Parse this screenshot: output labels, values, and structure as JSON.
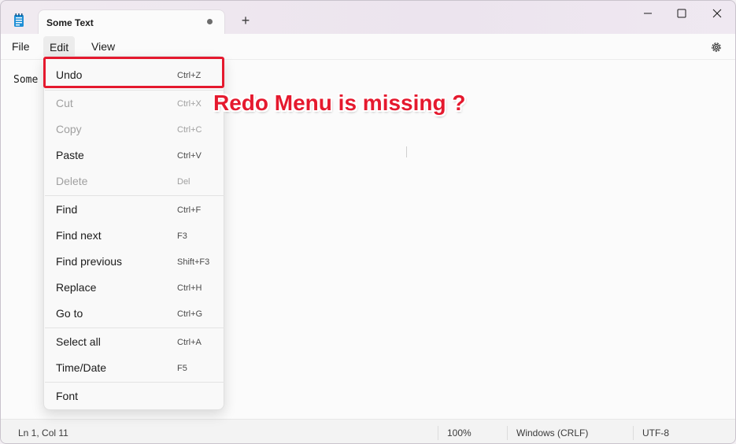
{
  "tab": {
    "title": "Some Text",
    "new_tab": "+"
  },
  "menubar": {
    "file": "File",
    "edit": "Edit",
    "view": "View"
  },
  "editor": {
    "text": "Some"
  },
  "edit_menu": {
    "items": [
      {
        "label": "Undo",
        "shortcut": "Ctrl+Z",
        "enabled": true
      },
      {
        "label": "Cut",
        "shortcut": "Ctrl+X",
        "enabled": false
      },
      {
        "label": "Copy",
        "shortcut": "Ctrl+C",
        "enabled": false
      },
      {
        "label": "Paste",
        "shortcut": "Ctrl+V",
        "enabled": true
      },
      {
        "label": "Delete",
        "shortcut": "Del",
        "enabled": false
      },
      {
        "label": "Find",
        "shortcut": "Ctrl+F",
        "enabled": true
      },
      {
        "label": "Find next",
        "shortcut": "F3",
        "enabled": true
      },
      {
        "label": "Find previous",
        "shortcut": "Shift+F3",
        "enabled": true
      },
      {
        "label": "Replace",
        "shortcut": "Ctrl+H",
        "enabled": true
      },
      {
        "label": "Go to",
        "shortcut": "Ctrl+G",
        "enabled": true
      },
      {
        "label": "Select all",
        "shortcut": "Ctrl+A",
        "enabled": true
      },
      {
        "label": "Time/Date",
        "shortcut": "F5",
        "enabled": true
      },
      {
        "label": "Font",
        "shortcut": "",
        "enabled": true
      }
    ]
  },
  "annotation": {
    "text": "Redo Menu is missing ?",
    "color": "#e5192e"
  },
  "statusbar": {
    "position": "Ln 1, Col 11",
    "zoom": "100%",
    "line_ending": "Windows (CRLF)",
    "encoding": "UTF-8"
  },
  "icons": {
    "app": "notepad-icon",
    "tab_modified": "unsaved-dot-icon",
    "minimize": "minimize-icon",
    "maximize": "maximize-icon",
    "close": "close-icon",
    "settings": "gear-icon"
  }
}
